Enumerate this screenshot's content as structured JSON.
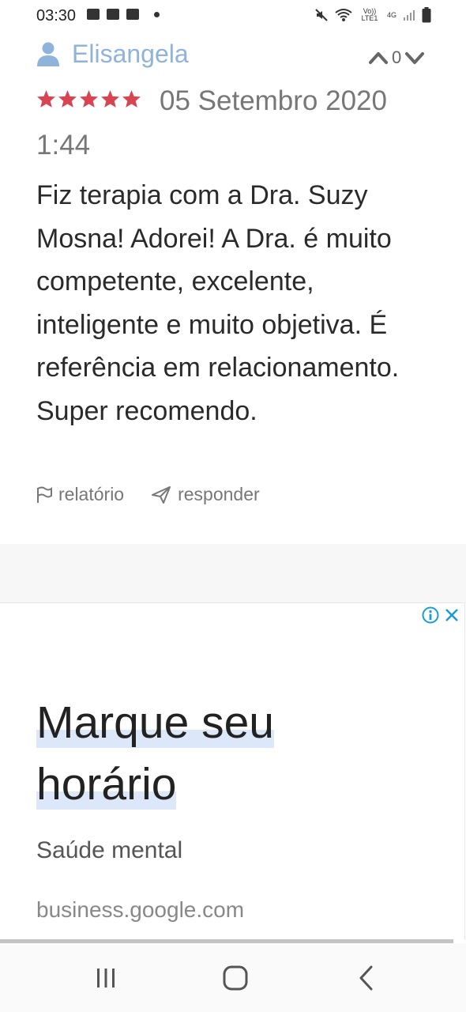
{
  "status_bar": {
    "time": "03:30",
    "volte_label": "Vo)) LTE1",
    "network_label": "4G"
  },
  "review": {
    "reviewer_name": "Elisangela",
    "rating": 5,
    "rating_max": 5,
    "star_color": "#d94452",
    "vote_count": "0",
    "date": "05 Setembro 2020 1:44",
    "text": "Fiz terapia com a Dra. Suzy Mosna! Adorei! A Dra. é muito competente, excelente, inteligente e muito objetiva. É referência em relacionamento. Super recomendo.",
    "actions": {
      "report_label": "relatório",
      "reply_label": "responder"
    }
  },
  "ad": {
    "title": "Marque seu horário",
    "subtitle": "Saúde mental",
    "domain": "business.google.com",
    "icons": [
      "info-icon",
      "close-icon"
    ]
  },
  "navigation_bar": {
    "icons": [
      "recent-apps-icon",
      "home-icon",
      "back-icon"
    ]
  }
}
